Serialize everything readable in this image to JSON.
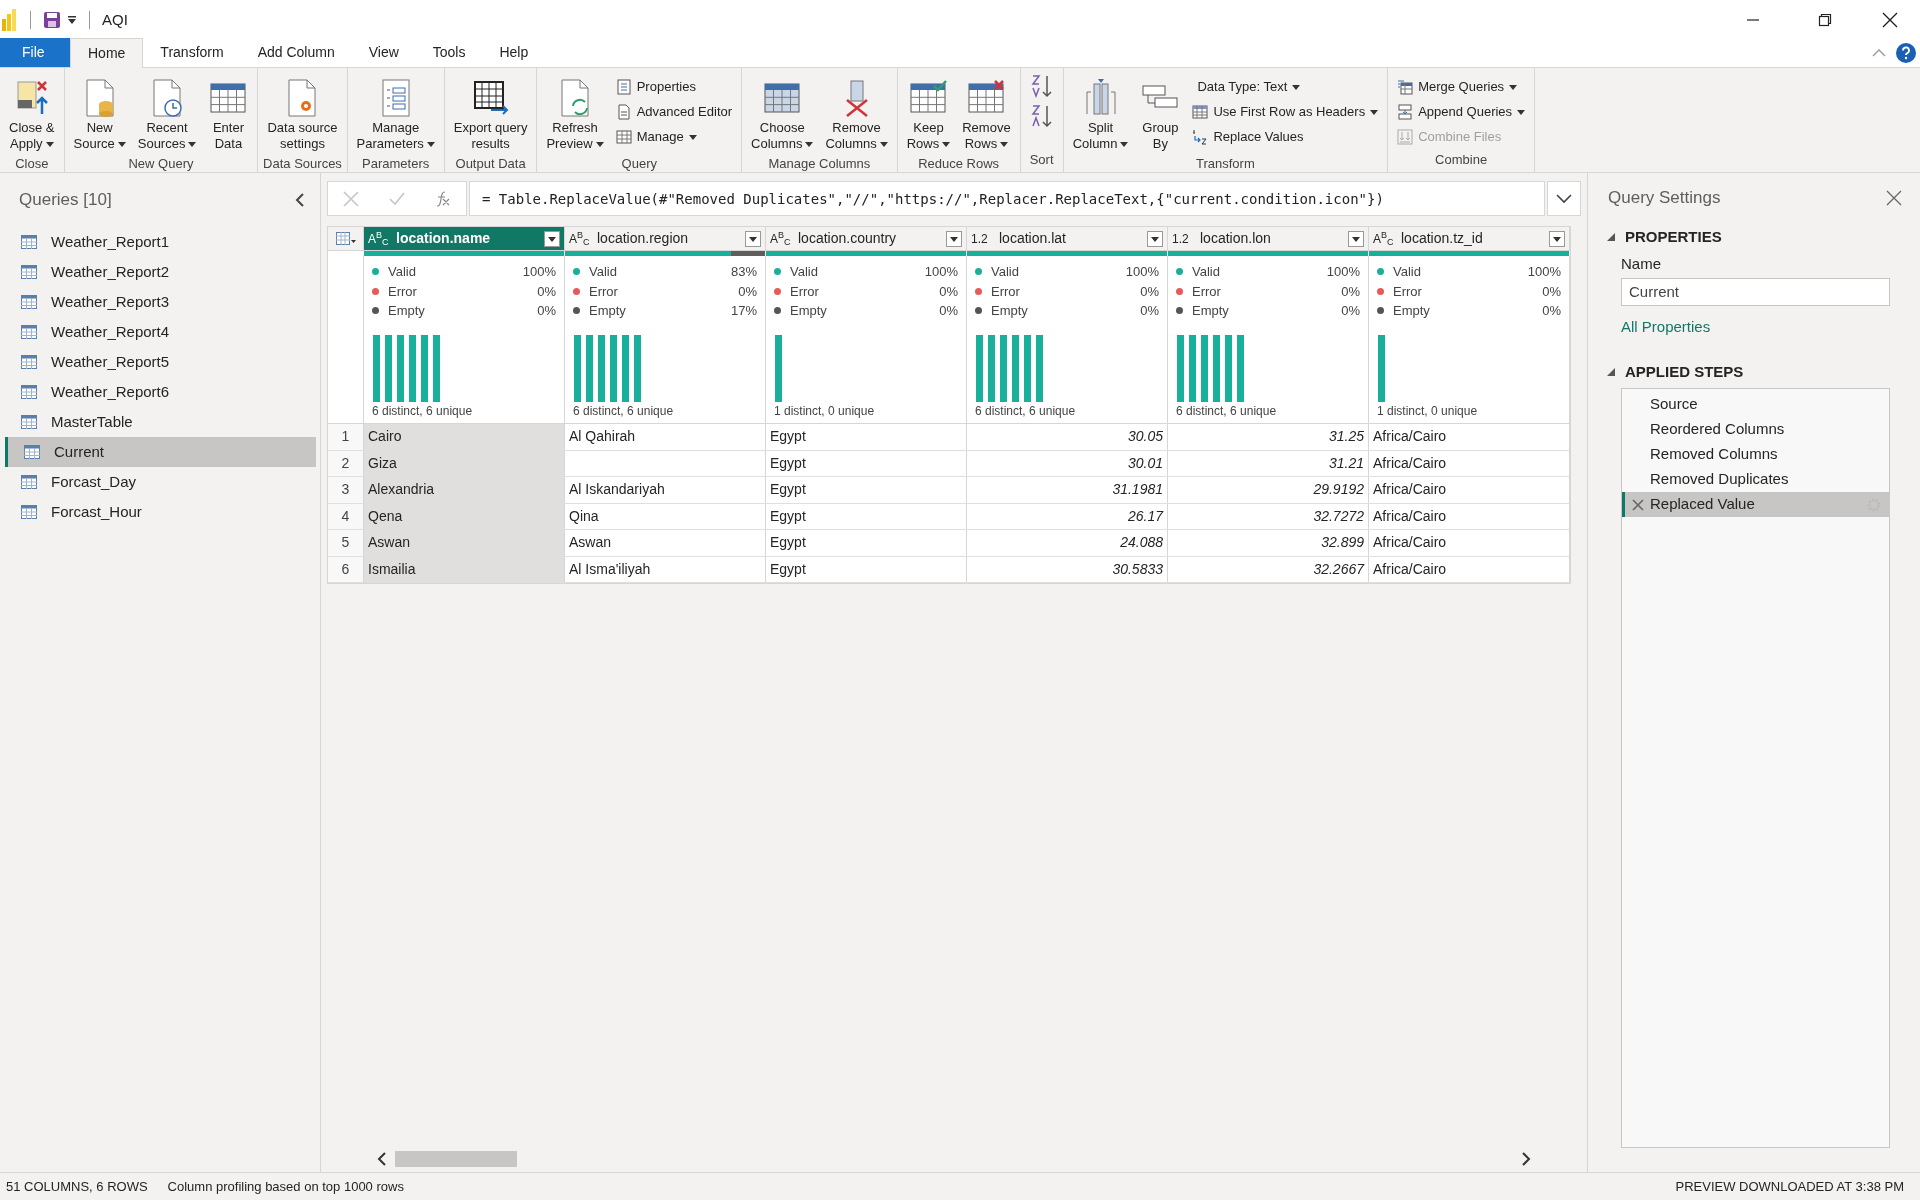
{
  "window": {
    "title": "AQI"
  },
  "menu_tabs": [
    {
      "label": "File",
      "kind": "file",
      "selected": false
    },
    {
      "label": "Home",
      "kind": "tab",
      "selected": true
    },
    {
      "label": "Transform",
      "kind": "tab",
      "selected": false
    },
    {
      "label": "Add Column",
      "kind": "tab",
      "selected": false
    },
    {
      "label": "View",
      "kind": "tab",
      "selected": false
    },
    {
      "label": "Tools",
      "kind": "tab",
      "selected": false
    },
    {
      "label": "Help",
      "kind": "tab",
      "selected": false
    }
  ],
  "ribbon_groups": [
    {
      "label": "Close",
      "buttons": [
        {
          "kind": "large",
          "lines": [
            "Close &",
            "Apply"
          ],
          "dropdown": true
        }
      ]
    },
    {
      "label": "New Query",
      "buttons": [
        {
          "kind": "large",
          "lines": [
            "New",
            "Source"
          ],
          "dropdown": true
        },
        {
          "kind": "large",
          "lines": [
            "Recent",
            "Sources"
          ],
          "dropdown": true
        },
        {
          "kind": "large",
          "lines": [
            "Enter",
            "Data"
          ],
          "dropdown": false
        }
      ]
    },
    {
      "label": "Data Sources",
      "buttons": [
        {
          "kind": "large",
          "lines": [
            "Data source",
            "settings"
          ],
          "dropdown": false
        }
      ]
    },
    {
      "label": "Parameters",
      "buttons": [
        {
          "kind": "large",
          "lines": [
            "Manage",
            "Parameters"
          ],
          "dropdown": true
        }
      ]
    },
    {
      "label": "Output Data",
      "buttons": [
        {
          "kind": "large",
          "lines": [
            "Export query",
            "results"
          ],
          "dropdown": false
        }
      ]
    },
    {
      "label": "Query",
      "buttons": [
        {
          "kind": "large",
          "lines": [
            "Refresh",
            "Preview"
          ],
          "dropdown": true
        },
        {
          "kind": "small",
          "lines": [
            "Properties"
          ],
          "dropdown": false
        },
        {
          "kind": "small",
          "lines": [
            "Advanced Editor"
          ],
          "dropdown": false
        },
        {
          "kind": "small",
          "lines": [
            "Manage"
          ],
          "dropdown": true
        }
      ]
    },
    {
      "label": "Manage Columns",
      "buttons": [
        {
          "kind": "large",
          "lines": [
            "Choose",
            "Columns"
          ],
          "dropdown": true
        },
        {
          "kind": "large",
          "lines": [
            "Remove",
            "Columns"
          ],
          "dropdown": true
        }
      ]
    },
    {
      "label": "Reduce Rows",
      "buttons": [
        {
          "kind": "large",
          "lines": [
            "Keep",
            "Rows"
          ],
          "dropdown": true
        },
        {
          "kind": "large",
          "lines": [
            "Remove",
            "Rows"
          ],
          "dropdown": true
        }
      ]
    },
    {
      "label": "Sort",
      "buttons": [
        {
          "kind": "icon"
        },
        {
          "kind": "icon"
        }
      ]
    },
    {
      "label": "Transform",
      "buttons": [
        {
          "kind": "large",
          "lines": [
            "Split",
            "Column"
          ],
          "dropdown": true
        },
        {
          "kind": "large",
          "lines": [
            "Group",
            "By"
          ],
          "dropdown": false
        },
        {
          "kind": "small",
          "lines": [
            "Data Type: Text"
          ],
          "dropdown": true
        },
        {
          "kind": "small",
          "lines": [
            "Use First Row as Headers"
          ],
          "dropdown": true
        },
        {
          "kind": "small",
          "lines": [
            "Replace Values"
          ],
          "dropdown": false
        }
      ]
    },
    {
      "label": "Combine",
      "buttons": [
        {
          "kind": "small",
          "lines": [
            "Merge Queries"
          ],
          "dropdown": true,
          "disabled": false
        },
        {
          "kind": "small",
          "lines": [
            "Append Queries"
          ],
          "dropdown": true,
          "disabled": false
        },
        {
          "kind": "small",
          "lines": [
            "Combine Files"
          ],
          "dropdown": false,
          "disabled": true
        }
      ]
    }
  ],
  "queries_pane": {
    "title": "Queries [10]",
    "items": [
      {
        "label": "Weather_Report1",
        "selected": false
      },
      {
        "label": "Weather_Report2",
        "selected": false
      },
      {
        "label": "Weather_Report3",
        "selected": false
      },
      {
        "label": "Weather_Report4",
        "selected": false
      },
      {
        "label": "Weather_Report5",
        "selected": false
      },
      {
        "label": "Weather_Report6",
        "selected": false
      },
      {
        "label": "MasterTable",
        "selected": false
      },
      {
        "label": "Current",
        "selected": true
      },
      {
        "label": "Forcast_Day",
        "selected": false
      },
      {
        "label": "Forcast_Hour",
        "selected": false
      }
    ]
  },
  "formula_bar": {
    "formula": "= Table.ReplaceValue(#\"Removed Duplicates\",\"//\",\"https://\",Replacer.ReplaceText,{\"current.condition.icon\"})"
  },
  "table": {
    "columns": [
      {
        "type": "A$^{B}$$_{C}$",
        "name": "location.name",
        "kind": "text",
        "selected": true,
        "level": 1,
        "valid": "100%",
        "error": "0%",
        "empty": "0%",
        "distribution": "6 distinct, 6 unique",
        "histogram": [
          {
            "kind": "bar"
          },
          {
            "kind": "bar"
          },
          {
            "kind": "bar"
          },
          {
            "kind": "bar"
          },
          {
            "kind": "bar"
          },
          {
            "kind": "bar"
          }
        ]
      },
      {
        "type": "A$^{B}$$_{C}$",
        "name": "location.region",
        "kind": "text",
        "selected": false,
        "level": 0.83,
        "valid": "83%",
        "error": "0%",
        "empty": "17%",
        "distribution": "6 distinct, 6 unique",
        "histogram": [
          {
            "kind": "bar"
          },
          {
            "kind": "bar"
          },
          {
            "kind": "bar"
          },
          {
            "kind": "bar"
          },
          {
            "kind": "bar"
          },
          {
            "kind": "bar"
          }
        ]
      },
      {
        "type": "A$^{B}$$_{C}$",
        "name": "location.country",
        "kind": "text",
        "selected": false,
        "level": 1,
        "valid": "100%",
        "error": "0%",
        "empty": "0%",
        "distribution": "1 distinct, 0 unique",
        "histogram": [
          {
            "kind": "bar"
          }
        ]
      },
      {
        "type": "1.2",
        "name": "location.lat",
        "kind": "number",
        "selected": false,
        "level": 1,
        "valid": "100%",
        "error": "0%",
        "empty": "0%",
        "distribution": "6 distinct, 6 unique",
        "histogram": [
          {
            "kind": "bar"
          },
          {
            "kind": "bar"
          },
          {
            "kind": "bar"
          },
          {
            "kind": "bar"
          },
          {
            "kind": "bar"
          },
          {
            "kind": "bar"
          }
        ]
      },
      {
        "type": "1.2",
        "name": "location.lon",
        "kind": "number",
        "selected": false,
        "level": 1,
        "valid": "100%",
        "error": "0%",
        "empty": "0%",
        "distribution": "6 distinct, 6 unique",
        "histogram": [
          {
            "kind": "bar"
          },
          {
            "kind": "bar"
          },
          {
            "kind": "bar"
          },
          {
            "kind": "bar"
          },
          {
            "kind": "bar"
          },
          {
            "kind": "bar"
          }
        ]
      },
      {
        "type": "A$^{B}$$_{C}$",
        "name": "location.tz_id",
        "kind": "text",
        "selected": false,
        "level": 1,
        "valid": "100%",
        "error": "0%",
        "empty": "0%",
        "distribution": "1 distinct, 0 unique",
        "histogram": [
          {
            "kind": "bar"
          }
        ]
      }
    ],
    "profile_labels": [
      [
        "Valid",
        "Error",
        "Empty"
      ],
      [
        "Valid",
        "Error",
        "Empty"
      ],
      [
        "Valid",
        "Error",
        "Empty"
      ],
      [
        "Valid",
        "Error",
        "Empty"
      ],
      [
        "Valid",
        "Error",
        "Empty"
      ],
      [
        "Valid",
        "Error",
        "Empty"
      ]
    ],
    "rows": [
      {
        "number": "1",
        "cells": [
          "Cairo",
          "Al Qahirah",
          "Egypt",
          "30.05",
          "31.25",
          "Africa/Cairo"
        ]
      },
      {
        "number": "2",
        "cells": [
          "Giza",
          "",
          "Egypt",
          "30.01",
          "31.21",
          "Africa/Cairo"
        ]
      },
      {
        "number": "3",
        "cells": [
          "Alexandria",
          "Al Iskandariyah",
          "Egypt",
          "31.1981",
          "29.9192",
          "Africa/Cairo"
        ]
      },
      {
        "number": "4",
        "cells": [
          "Qena",
          "Qina",
          "Egypt",
          "26.17",
          "32.7272",
          "Africa/Cairo"
        ]
      },
      {
        "number": "5",
        "cells": [
          "Aswan",
          "Aswan",
          "Egypt",
          "24.088",
          "32.899",
          "Africa/Cairo"
        ]
      },
      {
        "number": "6",
        "cells": [
          "Ismailia",
          "Al Isma'iliyah",
          "Egypt",
          "30.5833",
          "32.2667",
          "Africa/Cairo"
        ]
      }
    ]
  },
  "query_settings": {
    "title": "Query Settings",
    "properties_heading": "PROPERTIES",
    "name_label": "Name",
    "name_value": "Current",
    "all_properties_link": "All Properties",
    "steps_heading": "APPLIED STEPS",
    "steps": [
      {
        "label": "Source",
        "selected": false
      },
      {
        "label": "Reordered Columns",
        "selected": false
      },
      {
        "label": "Removed Columns",
        "selected": false
      },
      {
        "label": "Removed Duplicates",
        "selected": false
      },
      {
        "label": "Replaced Value",
        "selected": true
      }
    ]
  },
  "status_bar": {
    "left": [
      "51 COLUMNS, 6 ROWS",
      "Column profiling based on top 1000 rows"
    ],
    "right": "PREVIEW DOWNLOADED AT 3:38 PM"
  }
}
